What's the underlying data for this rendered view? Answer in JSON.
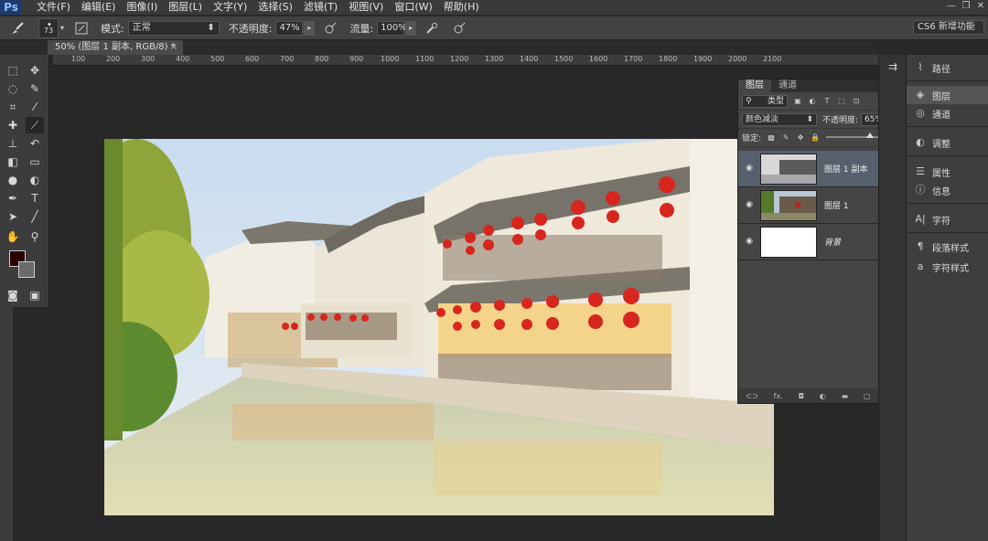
{
  "app": {
    "logo": "Ps",
    "menu": [
      "文件(F)",
      "编辑(E)",
      "图像(I)",
      "图层(L)",
      "文字(Y)",
      "选择(S)",
      "滤镜(T)",
      "视图(V)",
      "窗口(W)",
      "帮助(H)"
    ],
    "window_controls": [
      "—",
      "❐",
      "✕"
    ]
  },
  "options_bar": {
    "brush_size": "73",
    "mode_label": "模式:",
    "mode_value": "正常",
    "opacity_label": "不透明度:",
    "opacity_value": "47%",
    "flow_label": "流量:",
    "flow_value": "100%",
    "workspace": "CS6 新增功能"
  },
  "document_tab": {
    "title": "50% (图层 1 副本, RGB/8) *",
    "close": "×"
  },
  "ruler_ticks": [
    "100",
    "200",
    "300",
    "400",
    "500",
    "600",
    "700",
    "800",
    "900",
    "1000",
    "1100",
    "1200",
    "1300",
    "1400",
    "1500",
    "1600",
    "1700",
    "1800",
    "1900",
    "2000",
    "2100"
  ],
  "layers_panel": {
    "tabs": [
      "图层",
      "通道"
    ],
    "filter_kind": "类型",
    "blend_mode": "颜色减淡",
    "opacity_label": "不透明度:",
    "opacity_value": "65%",
    "opacity_level": 0.6,
    "lock_label": "锁定:",
    "layers": [
      {
        "name": "图层 1 副本",
        "selected": true
      },
      {
        "name": "图层 1",
        "selected": false
      },
      {
        "name": "背景",
        "selected": false,
        "locked": true
      }
    ],
    "bottom_icons": [
      "link-icon",
      "fx-icon",
      "mask-icon",
      "adjustment-icon",
      "group-icon",
      "new-layer-icon",
      "trash-icon"
    ],
    "fx_label": "fx."
  },
  "right_panel": {
    "items": [
      {
        "label": "路径",
        "icon": "path-icon"
      },
      {
        "label": "图层",
        "icon": "layers-icon"
      },
      {
        "label": "通道",
        "icon": "channels-icon"
      },
      {
        "label": "调整",
        "icon": "adjust-icon"
      },
      {
        "label": "属性",
        "icon": "properties-icon"
      },
      {
        "label": "信息",
        "icon": "info-icon"
      },
      {
        "label": "字符",
        "icon": "character-icon"
      },
      {
        "label": "段落样式",
        "icon": "paragraph-style-icon"
      },
      {
        "label": "字符样式",
        "icon": "character-style-icon"
      }
    ]
  },
  "colors": {
    "foreground": "#2a0000",
    "background": "#6a6a6a",
    "selection": "#56606d",
    "annotation_arrow": "#b22222"
  }
}
